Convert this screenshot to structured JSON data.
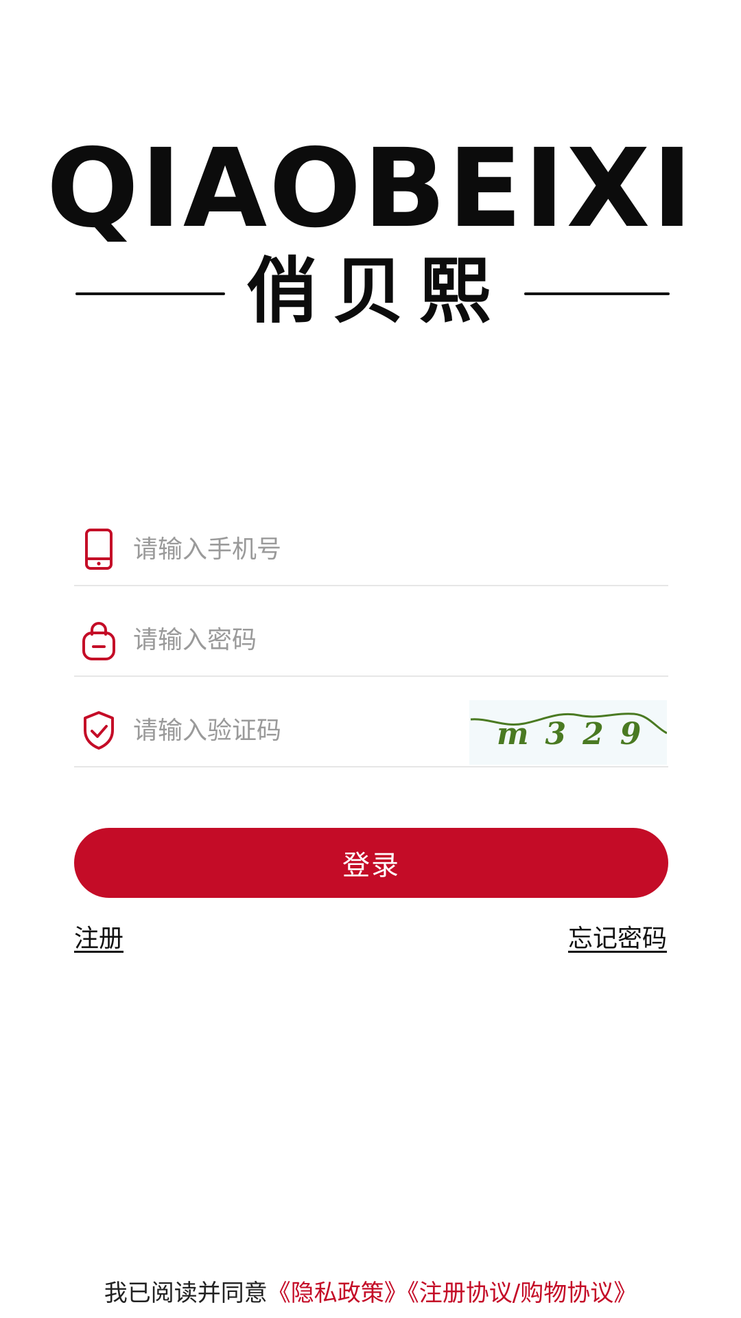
{
  "brand": {
    "wordmark": "QIAOBEIXI",
    "chinese_name": "俏贝熙"
  },
  "form": {
    "phone_placeholder": "请输入手机号",
    "phone_value": "",
    "password_placeholder": "请输入密码",
    "password_value": "",
    "captcha_placeholder": "请输入验证码",
    "captcha_value": "",
    "captcha_text": "m329"
  },
  "actions": {
    "login_label": "登录",
    "register_label": "注册",
    "forgot_label": "忘记密码"
  },
  "agreement": {
    "prefix": "我已阅读并同意",
    "privacy_link": "《隐私政策》",
    "terms_link": "《注册协议/购物协议》"
  },
  "icons": {
    "phone": "mobile-phone-icon",
    "password": "lock-icon",
    "captcha": "shield-check-icon"
  },
  "colors": {
    "accent": "#c40c27",
    "placeholder": "#9a9a9a",
    "divider": "#e6e6e6",
    "captcha_bg": "#f3f9fb",
    "captcha_ink": "#4a7a22"
  }
}
